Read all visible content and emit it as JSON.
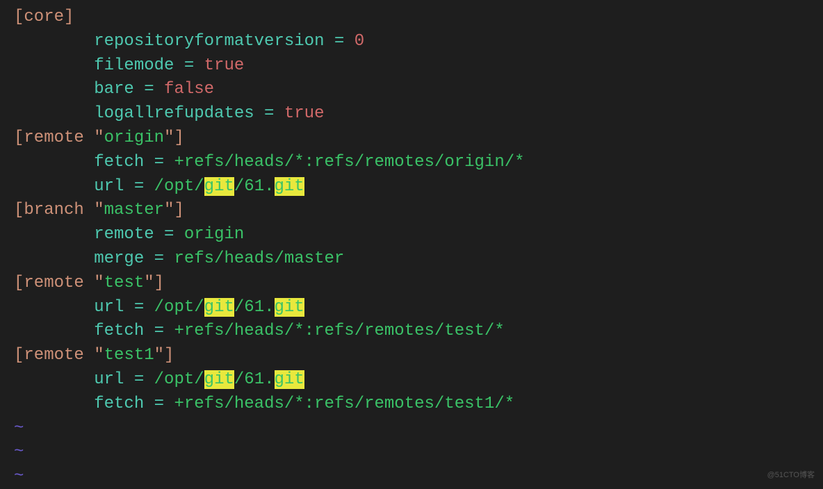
{
  "lines": {
    "l1": {
      "bracket_open": "[",
      "section": "core",
      "bracket_close": "]"
    },
    "l2": {
      "key": "repositoryformatversion",
      "eq": " = ",
      "val": "0"
    },
    "l3": {
      "key": "filemode",
      "eq": " = ",
      "val": "true"
    },
    "l4": {
      "key": "bare",
      "eq": " = ",
      "val": "false"
    },
    "l5": {
      "key": "logallrefupdates",
      "eq": " = ",
      "val": "true"
    },
    "l6": {
      "bracket_open": "[",
      "section": "remote",
      "quote1": " \"",
      "name": "origin",
      "quote2": "\"]"
    },
    "l7": {
      "key": "fetch",
      "eq": " = ",
      "val": "+refs/heads/*:refs/remotes/origin/*"
    },
    "l8": {
      "key": "url",
      "eq": " = ",
      "p1": "/opt/",
      "hl1": "git",
      "p2": "/61.",
      "hl2": "git"
    },
    "l9": {
      "bracket_open": "[",
      "section": "branch",
      "quote1": " \"",
      "name": "master",
      "quote2": "\"]"
    },
    "l10": {
      "key": "remote",
      "eq": " = ",
      "val": "origin"
    },
    "l11": {
      "key": "merge",
      "eq": " = ",
      "val": "refs/heads/master"
    },
    "l12": {
      "bracket_open": "[",
      "section": "remote",
      "quote1": " \"",
      "name": "test",
      "quote2": "\"]"
    },
    "l13": {
      "key": "url",
      "eq": " = ",
      "p1": "/opt/",
      "hl1": "git",
      "p2": "/61.",
      "hl2": "git"
    },
    "l14": {
      "key": "fetch",
      "eq": " = ",
      "val": "+refs/heads/*:refs/remotes/test/*"
    },
    "l15": {
      "bracket_open": "[",
      "section": "remote",
      "quote1": " \"",
      "name": "test1",
      "quote2": "\"]"
    },
    "l16": {
      "key": "url",
      "eq": " = ",
      "p1": "/opt/",
      "hl1": "git",
      "p2": "/61.",
      "hl2": "git"
    },
    "l17": {
      "key": "fetch",
      "eq": " = ",
      "val": "+refs/heads/*:refs/remotes/test1/*"
    },
    "tilde": "~",
    "watermark": "@51CTO博客"
  }
}
